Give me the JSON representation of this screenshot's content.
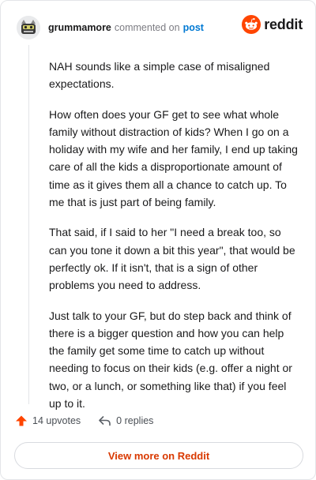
{
  "header": {
    "username": "grummamore",
    "action": "commented on",
    "target": "post",
    "brand": "reddit",
    "avatar_icon": "avatar-icon",
    "brand_icon": "reddit-snoo-icon",
    "brand_color": "#ff4500"
  },
  "comment": {
    "paragraphs": [
      "NAH sounds like a simple case of misaligned expectations.",
      "How often does your GF get to see what whole family without distraction of kids? When I go on a holiday with my wife and her family, I end up taking care of all the kids a disproportionate amount of time as it gives them all a chance to catch up. To me that is just part of being family.",
      "That said, if I said to her \"I need a break too, so can you tone it down a bit this year\", that would be perfectly ok. If it isn't, that is a sign of other problems you need to address.",
      "Just talk to your GF, but do step back and think of there is a bigger question and how you can help the family get some time to catch up without needing to focus on their kids (e.g. offer a night or two, or a lunch, or something like that) if you feel up to it."
    ]
  },
  "actions": {
    "upvotes": "14 upvotes",
    "replies": "0 replies",
    "upvote_icon": "upvote-arrow-icon",
    "reply_icon": "reply-icon",
    "upvote_color": "#ff4500"
  },
  "footer": {
    "view_more": "View more on Reddit",
    "accent": "#d93900"
  }
}
